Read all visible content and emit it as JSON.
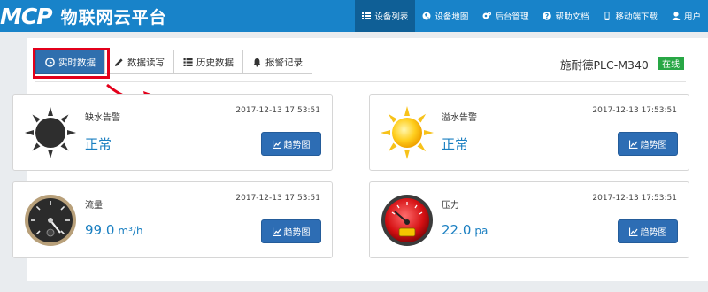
{
  "brand": {
    "logo": "MCP",
    "name": "物联网云平台"
  },
  "nav": {
    "items": [
      {
        "label": "设备列表",
        "icon": "list-icon",
        "active": true
      },
      {
        "label": "设备地图",
        "icon": "globe-icon",
        "active": false
      },
      {
        "label": "后台管理",
        "icon": "gears-icon",
        "active": false
      },
      {
        "label": "帮助文档",
        "icon": "question-icon",
        "active": false
      },
      {
        "label": "移动端下载",
        "icon": "mobile-icon",
        "active": false
      },
      {
        "label": "用户",
        "icon": "user-icon",
        "active": false
      }
    ]
  },
  "tabs": [
    {
      "label": "实时数据",
      "icon": "clock-icon",
      "active": true
    },
    {
      "label": "数据读写",
      "icon": "pencil-icon",
      "active": false
    },
    {
      "label": "历史数据",
      "icon": "list-icon",
      "active": false
    },
    {
      "label": "报警记录",
      "icon": "bell-icon",
      "active": false
    }
  ],
  "device": {
    "name": "施耐德PLC-M340",
    "status": "在线"
  },
  "cards": [
    {
      "title": "缺水告警",
      "time": "2017-12-13 17:53:51",
      "value": "正常",
      "unit": "",
      "icon": "dark-sun-icon"
    },
    {
      "title": "溢水告警",
      "time": "2017-12-13 17:53:51",
      "value": "正常",
      "unit": "",
      "icon": "sun-icon"
    },
    {
      "title": "流量",
      "time": "2017-12-13 17:53:51",
      "value": "99.0",
      "unit": "m³/h",
      "icon": "flow-gauge-icon"
    },
    {
      "title": "压力",
      "time": "2017-12-13 17:53:51",
      "value": "22.0",
      "unit": "pa",
      "icon": "pressure-gauge-icon"
    }
  ],
  "trend_button_label": "趋势图",
  "colors": {
    "navbar": "#1883c9",
    "nav_active": "#0f5f96",
    "tab_active": "#2f6fae",
    "value": "#1a7fc1",
    "button": "#2d6db4",
    "status_online": "#28a745",
    "highlight": "#e3001b"
  }
}
